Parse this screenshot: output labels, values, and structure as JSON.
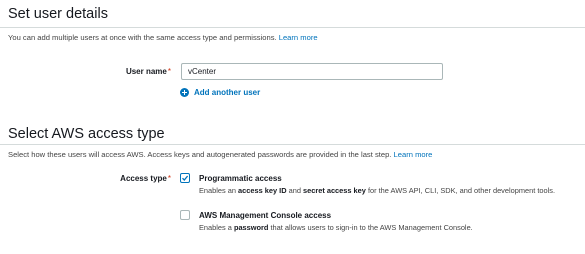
{
  "user_details": {
    "title": "Set user details",
    "description": "You can add multiple users at once with the same access type and permissions.",
    "learn_more": "Learn more",
    "user_name_label": "User name",
    "required_mark": "*",
    "user_name_value": "vCenter",
    "add_another_user": "Add another user"
  },
  "access_type": {
    "title": "Select AWS access type",
    "description": "Select how these users will access AWS. Access keys and autogenerated passwords are provided in the last step.",
    "learn_more": "Learn more",
    "label": "Access type",
    "required_mark": "*",
    "options": [
      {
        "title": "Programmatic access",
        "checked": true,
        "desc_1": "Enables an ",
        "desc_bold_1": "access key ID",
        "desc_2": " and ",
        "desc_bold_2": "secret access key",
        "desc_3": " for the AWS API, CLI, SDK, and other development tools."
      },
      {
        "title": "AWS Management Console access",
        "checked": false,
        "desc_1": "Enables a ",
        "desc_bold_1": "password",
        "desc_2": " that allows users to sign-in to the AWS Management Console."
      }
    ]
  },
  "colors": {
    "accent": "#0073bb",
    "required": "#d13212",
    "border": "#aab7b8",
    "divider": "#d5dbdb"
  }
}
